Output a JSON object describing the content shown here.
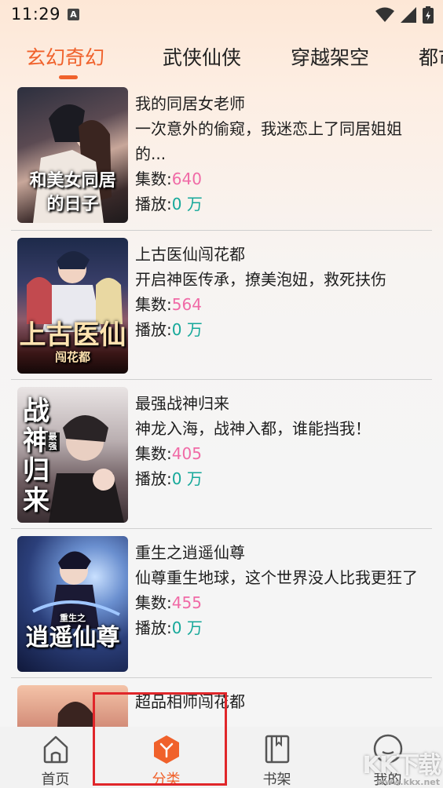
{
  "status": {
    "time": "11:29",
    "badge": "A"
  },
  "tabs": [
    {
      "label": "玄幻奇幻"
    },
    {
      "label": "武侠仙侠"
    },
    {
      "label": "穿越架空"
    },
    {
      "label": "都市"
    }
  ],
  "labels": {
    "episodes": "集数:",
    "plays": "播放:",
    "unit": " 万"
  },
  "books": [
    {
      "title": "我的同居女老师",
      "desc": "一次意外的偷窥，我迷恋上了同居姐姐的...",
      "episodes": "640",
      "plays": "0",
      "cover_text": "和美女同居的日子"
    },
    {
      "title": "上古医仙闯花都",
      "desc": "开启神医传承，撩美泡妞，救死扶伤",
      "episodes": "564",
      "plays": "0",
      "cover_text": "上古医仙",
      "cover_sub": "闯花都"
    },
    {
      "title": "最强战神归来",
      "desc": "神龙入海，战神入都，谁能挡我！",
      "episodes": "405",
      "plays": "0",
      "cover_text": "战神归来",
      "cover_sub": "最强"
    },
    {
      "title": "重生之逍遥仙尊",
      "desc": "仙尊重生地球，这个世界没人比我更狂了",
      "episodes": "455",
      "plays": "0",
      "cover_text": "逍遥仙尊",
      "cover_sub": "重生之"
    },
    {
      "title": "超品相师闯花都",
      "desc": "",
      "episodes": "",
      "plays": ""
    }
  ],
  "nav": [
    {
      "label": "首页",
      "icon": "home-icon"
    },
    {
      "label": "分类",
      "icon": "category-icon"
    },
    {
      "label": "书架",
      "icon": "bookshelf-icon"
    },
    {
      "label": "我的",
      "icon": "profile-icon"
    }
  ],
  "watermark": {
    "main": "KK下载",
    "sub": "www.kkx.net"
  },
  "colors": {
    "accent": "#f0612b",
    "episodes": "#f06aa6",
    "plays": "#15a89a",
    "highlight": "#e0262a"
  }
}
